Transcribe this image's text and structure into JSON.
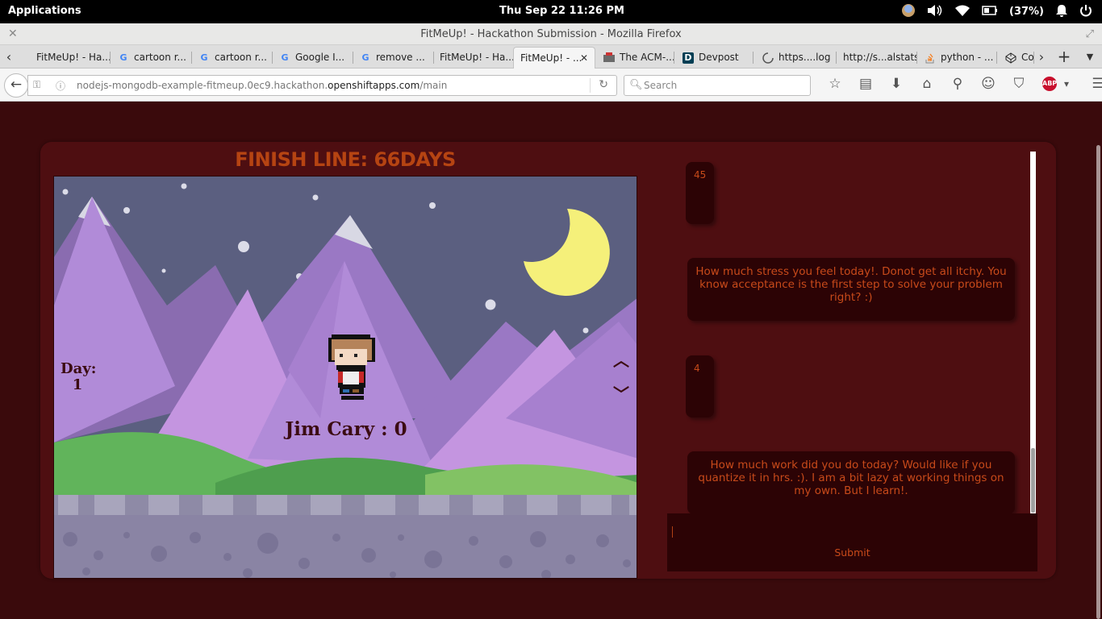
{
  "topbar": {
    "applications": "Applications",
    "clock": "Thu Sep 22    11:26 PM",
    "battery": "(37%)"
  },
  "window": {
    "title": "FitMeUp! - Hackathon Submission - Mozilla Firefox"
  },
  "tabs": [
    {
      "label": "FitMeUp! - Ha...",
      "icon": "none"
    },
    {
      "label": "cartoon r...",
      "icon": "google-icon"
    },
    {
      "label": "cartoon r...",
      "icon": "google-icon"
    },
    {
      "label": "Google I...",
      "icon": "google-icon"
    },
    {
      "label": "remove ...",
      "icon": "google-icon"
    },
    {
      "label": "FitMeUp! - Ha...",
      "icon": "none"
    },
    {
      "label": "FitMeUp! - ...",
      "icon": "none",
      "active": true
    },
    {
      "label": "The ACM-...",
      "icon": "acm-icon"
    },
    {
      "label": "Devpost",
      "icon": "devpost-icon"
    },
    {
      "label": "https....log",
      "icon": "loading-icon"
    },
    {
      "label": "http://s...alstats",
      "icon": "none"
    },
    {
      "label": "python - ...",
      "icon": "stackoverflow-icon"
    },
    {
      "label": "Co",
      "icon": "codepen-icon"
    }
  ],
  "nav": {
    "url_prefix": "nodejs-mongodb-example-fitmeup.0ec9.hackathon.",
    "url_domain": "openshiftapps.com",
    "url_suffix": "/main",
    "search_placeholder": "Search",
    "abp": "ABP"
  },
  "game": {
    "heading": "FINISH LINE: 66DAYS",
    "day_label": "Day:",
    "day_value": "1",
    "player_score": "Jim Cary : 0"
  },
  "chat": {
    "messages": [
      {
        "type": "answer",
        "text": "45"
      },
      {
        "type": "question",
        "text": "How much stress you feel today!. Donot get all itchy. You know acceptance is the first step to solve your problem right? :)"
      },
      {
        "type": "answer",
        "text": "4"
      },
      {
        "type": "question",
        "text": "How much work did you do today? Would like if you quantize it in hrs. :). I am a bit lazy at working things on my own. But I learn!."
      }
    ],
    "submit_label": "Submit"
  }
}
